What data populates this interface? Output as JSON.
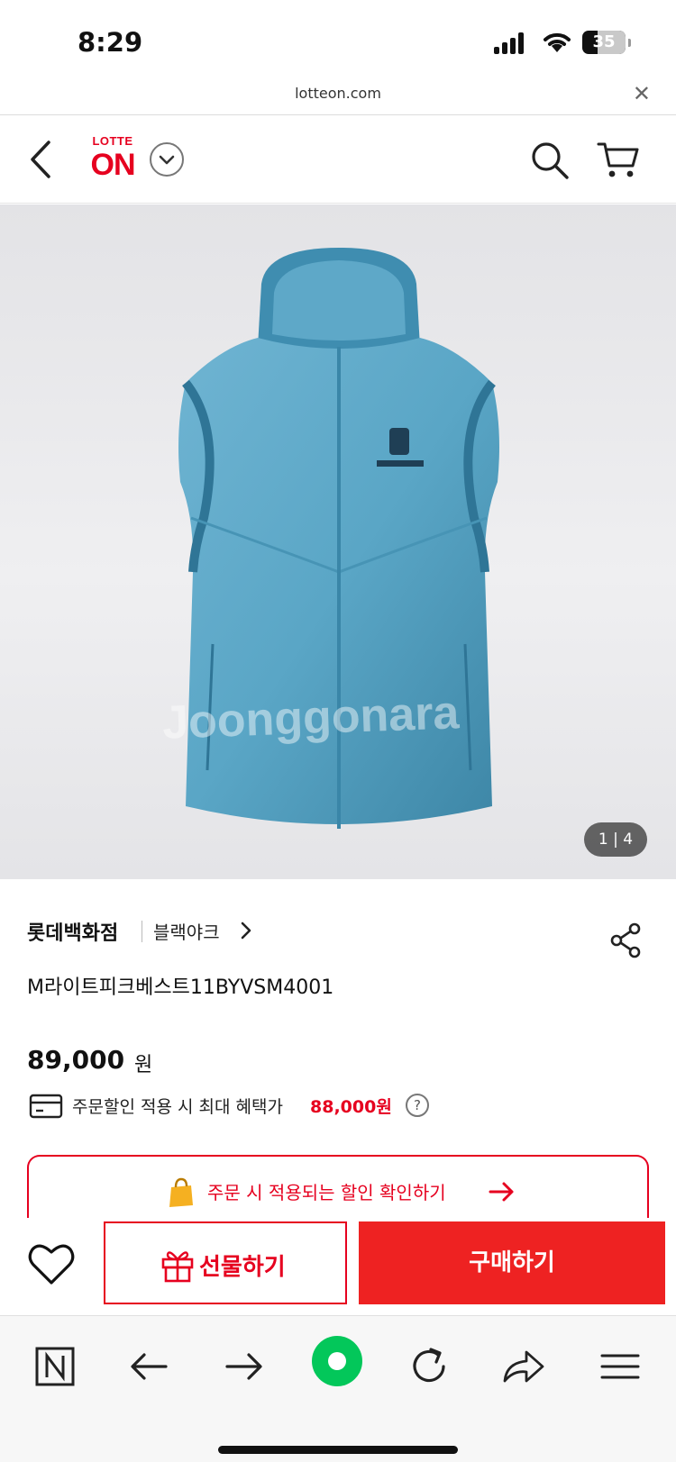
{
  "status_bar": {
    "time": "8:29",
    "battery": "35",
    "battery_level": 0.35
  },
  "browser": {
    "url": "lotteon.com",
    "close_label": "✕"
  },
  "header": {
    "logo_top": "LOTTE",
    "logo_main": "ON"
  },
  "gallery": {
    "watermark": "Joonggonara",
    "counter": "1 | 4",
    "current": 1,
    "total": 4
  },
  "product": {
    "seller": "롯데백화점",
    "brand": "블랙야크",
    "title": "M라이트피크베스트11BYVSM4001",
    "price": "89,000",
    "price_unit": "원",
    "benefit_label": "주문할인 적용 시 최대 혜택가",
    "benefit_price": "88,000원",
    "help_label": "?"
  },
  "discount_banner": {
    "label": "주문 시 적용되는 할인 확인하기"
  },
  "actions": {
    "gift_label": "선물하기",
    "buy_label": "구매하기"
  },
  "colors": {
    "accent": "#e6001f",
    "buy_button": "#ee2222",
    "navigator_green": "#03c75a",
    "vest": "#4f9cbd"
  },
  "icons": [
    "back-icon",
    "chevron-down-icon",
    "search-icon",
    "cart-icon",
    "share-icon",
    "chevron-right-icon",
    "card-icon",
    "help-icon",
    "shopping-bag-icon",
    "arrow-right-icon",
    "heart-icon",
    "gift-icon",
    "naver-n-icon",
    "back-arrow-icon",
    "forward-arrow-icon",
    "green-dot-icon",
    "reload-icon",
    "share-arrow-icon",
    "menu-icon"
  ]
}
